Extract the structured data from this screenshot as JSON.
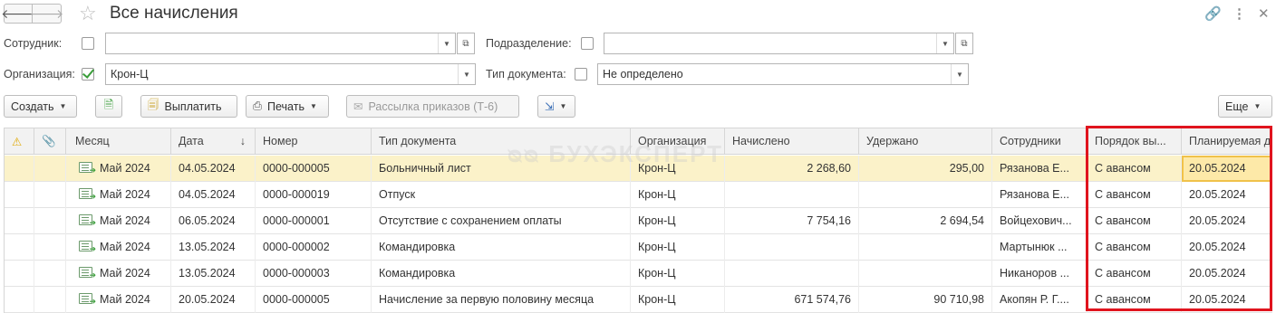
{
  "window": {
    "title": "Все начисления",
    "back_icon": "arrow-left-icon",
    "forward_icon": "arrow-right-icon",
    "favorite_icon": "star-icon",
    "link_icon": "link-icon",
    "more_icon": "vertical-dots-icon",
    "close_icon": "close-icon"
  },
  "filters": {
    "employee_label": "Сотрудник:",
    "employee_value": "",
    "department_label": "Подразделение:",
    "department_value": "",
    "organization_label": "Организация:",
    "organization_value": "Крон-Ц",
    "doctype_label": "Тип документа:",
    "doctype_value": "Не определено"
  },
  "toolbar": {
    "create": "Создать",
    "pay": "Выплатить",
    "print": "Печать",
    "mailing": "Рассылка приказов (Т-6)",
    "more": "Еще"
  },
  "table": {
    "headers": {
      "month": "Месяц",
      "date": "Дата",
      "number": "Номер",
      "doctype": "Тип документа",
      "org": "Организация",
      "accrued": "Начислено",
      "withheld": "Удержано",
      "employees": "Сотрудники",
      "order": "Порядок вы...",
      "planned": "Планируемая д"
    },
    "rows": [
      {
        "month": "Май 2024",
        "date": "04.05.2024",
        "number": "0000-000005",
        "doctype": "Больничный лист",
        "org": "Крон-Ц",
        "accrued": "2 268,60",
        "withheld": "295,00",
        "employees": "Рязанова Е...",
        "order": "С авансом",
        "planned": "20.05.2024"
      },
      {
        "month": "Май 2024",
        "date": "04.05.2024",
        "number": "0000-000019",
        "doctype": "Отпуск",
        "org": "Крон-Ц",
        "accrued": "",
        "withheld": "",
        "employees": "Рязанова Е...",
        "order": "С авансом",
        "planned": "20.05.2024"
      },
      {
        "month": "Май 2024",
        "date": "06.05.2024",
        "number": "0000-000001",
        "doctype": "Отсутствие с сохранением оплаты",
        "org": "Крон-Ц",
        "accrued": "7 754,16",
        "withheld": "2 694,54",
        "employees": "Войцехович...",
        "order": "С авансом",
        "planned": "20.05.2024"
      },
      {
        "month": "Май 2024",
        "date": "13.05.2024",
        "number": "0000-000002",
        "doctype": "Командировка",
        "org": "Крон-Ц",
        "accrued": "",
        "withheld": "",
        "employees": "Мартынюк ...",
        "order": "С авансом",
        "planned": "20.05.2024"
      },
      {
        "month": "Май 2024",
        "date": "13.05.2024",
        "number": "0000-000003",
        "doctype": "Командировка",
        "org": "Крон-Ц",
        "accrued": "",
        "withheld": "",
        "employees": "Никаноров ...",
        "order": "С авансом",
        "planned": "20.05.2024"
      },
      {
        "month": "Май 2024",
        "date": "20.05.2024",
        "number": "0000-000005",
        "doctype": "Начисление за первую половину месяца",
        "org": "Крон-Ц",
        "accrued": "671 574,76",
        "withheld": "90 710,98",
        "employees": "Акопян Р. Г....",
        "order": "С авансом",
        "planned": "20.05.2024"
      }
    ]
  },
  "watermark": "БУХЭКСПЕРТ",
  "colors": {
    "selected_row": "#fbf2c9",
    "highlight_box": "#e0141e",
    "check": "#3a9d3a"
  }
}
